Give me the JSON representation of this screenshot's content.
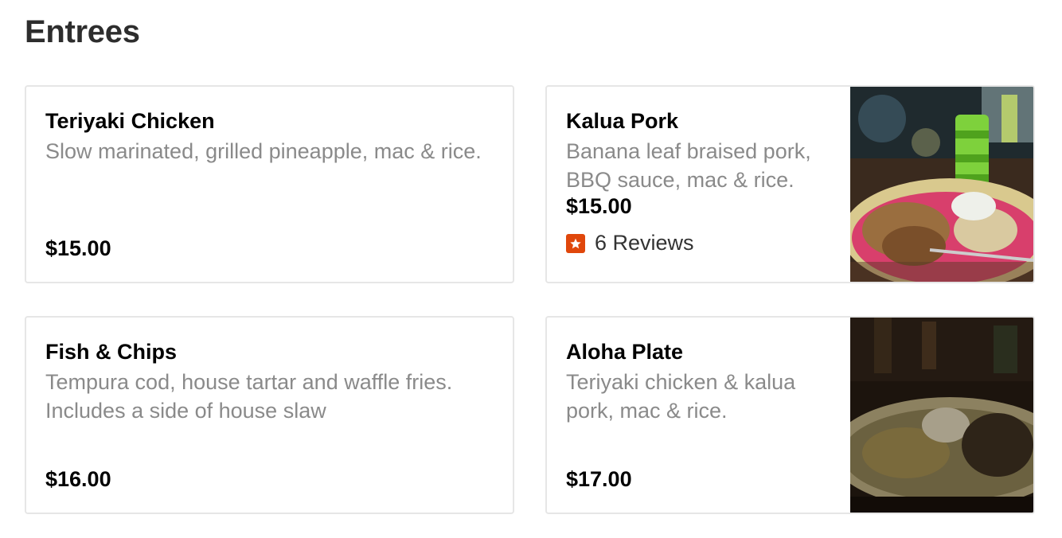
{
  "section": {
    "title": "Entrees"
  },
  "items": [
    {
      "name": "Teriyaki Chicken",
      "description": "Slow marinated, grilled pineapple, mac & rice.",
      "price": "$15.00"
    },
    {
      "name": "Kalua Pork",
      "description": "Banana leaf braised pork, BBQ sauce, mac & rice.",
      "price": "$15.00",
      "reviews": "6 Reviews",
      "photo": "food-photo"
    },
    {
      "name": "Fish & Chips",
      "description": "Tempura cod, house tartar and waffle fries. Includes a side of house slaw",
      "price": "$16.00"
    },
    {
      "name": "Aloha Plate",
      "description": "Teriyaki chicken & kalua pork, mac & rice.",
      "price": "$17.00",
      "photo": "food-photo"
    }
  ],
  "colors": {
    "review_badge": "#e0470b",
    "description_text": "#8a8a8a",
    "card_border": "#e6e6e6"
  }
}
